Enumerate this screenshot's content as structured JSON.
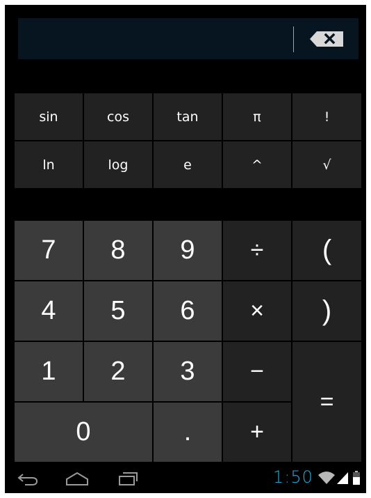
{
  "display": {
    "value": "",
    "backspace_icon": "backspace-icon"
  },
  "scientific_keys": [
    [
      "sin",
      "cos",
      "tan",
      "π",
      "!"
    ],
    [
      "ln",
      "log",
      "e",
      "^",
      "√"
    ]
  ],
  "numeric_keys": {
    "seven": "7",
    "eight": "8",
    "nine": "9",
    "divide": "÷",
    "open_paren": "(",
    "four": "4",
    "five": "5",
    "six": "6",
    "multiply": "×",
    "close_paren": ")",
    "one": "1",
    "two": "2",
    "three": "3",
    "minus": "−",
    "zero": "0",
    "decimal": ".",
    "plus": "+",
    "equals": "="
  },
  "navbar": {
    "back_icon": "back-icon",
    "home_icon": "home-icon",
    "recent_apps_icon": "recent-apps-icon",
    "time": "1:50",
    "wifi_icon": "wifi-icon",
    "signal_icon": "signal-icon",
    "battery_icon": "battery-icon"
  },
  "colors": {
    "accent": "#29a6d6",
    "display_bg": "#071520",
    "number_key": "#3b3b3b",
    "operator_key": "#222222",
    "background": "#000000"
  }
}
